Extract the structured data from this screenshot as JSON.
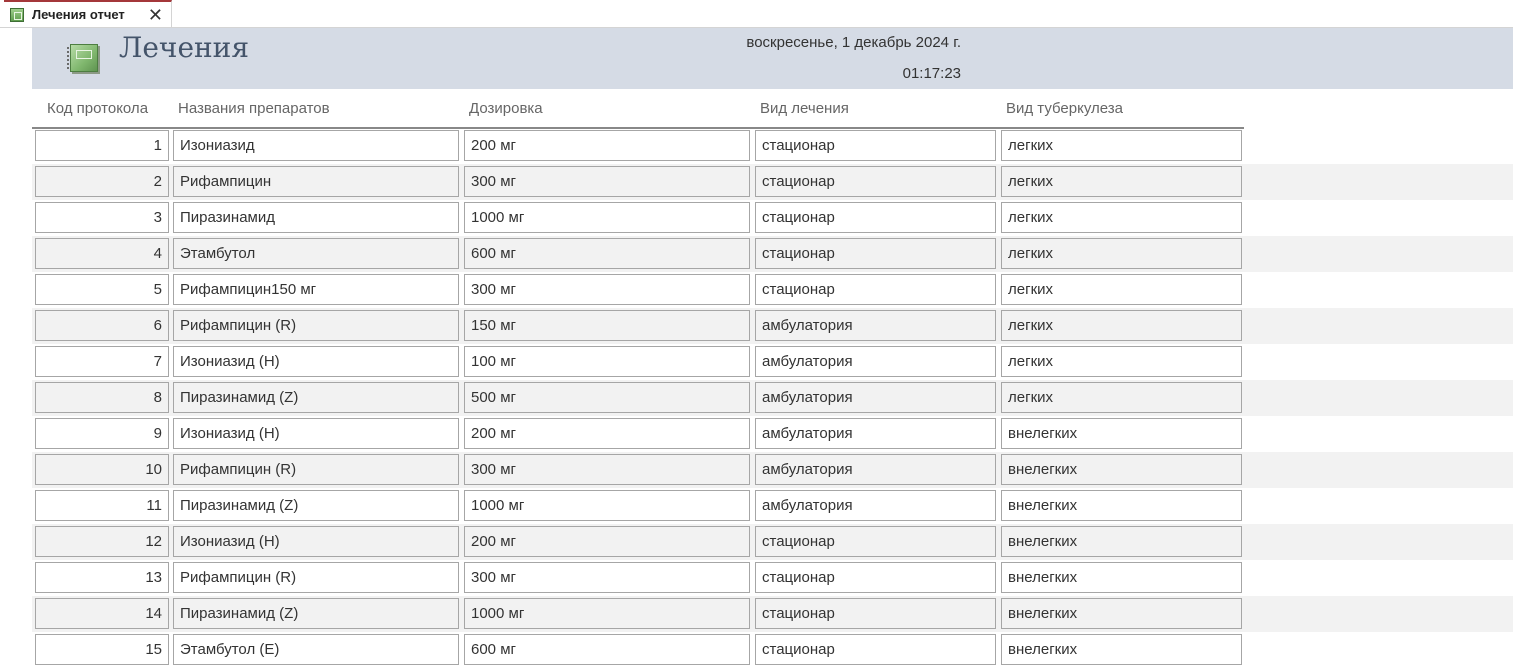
{
  "tab": {
    "title": "Лечения отчет",
    "close_glyph": "✕",
    "icon": "report-icon",
    "accent": "#a4373a"
  },
  "header": {
    "title": "Лечения",
    "date": "воскресенье, 1 декабрь 2024 г.",
    "time": "01:17:23",
    "background": "#d5dbe5",
    "title_color": "#44546a",
    "icon": "report-icon"
  },
  "columns": {
    "id": "Код протокола",
    "name": "Названия препаратов",
    "dose": "Дозировка",
    "type": "Вид лечения",
    "tb": "Вид туберкулеза"
  },
  "rows": [
    {
      "id": "1",
      "name": "Изониазид",
      "dose": "200 мг",
      "type": "стационар",
      "tb": "легких"
    },
    {
      "id": "2",
      "name": "Рифампицин",
      "dose": "300 мг",
      "type": "стационар",
      "tb": "легких"
    },
    {
      "id": "3",
      "name": "Пиразинамид",
      "dose": "1000 мг",
      "type": "стационар",
      "tb": "легких"
    },
    {
      "id": "4",
      "name": "Этамбутол",
      "dose": "600 мг",
      "type": "стационар",
      "tb": "легких"
    },
    {
      "id": "5",
      "name": "Рифампицин150 мг",
      "dose": "300 мг",
      "type": "стационар",
      "tb": "легких"
    },
    {
      "id": "6",
      "name": "Рифампицин (R)",
      "dose": "150 мг",
      "type": "амбулатория",
      "tb": "легких"
    },
    {
      "id": "7",
      "name": "Изониазид (H)",
      "dose": "100 мг",
      "type": "амбулатория",
      "tb": "легких"
    },
    {
      "id": "8",
      "name": "Пиразинамид (Z)",
      "dose": "500 мг",
      "type": "амбулатория",
      "tb": "легких"
    },
    {
      "id": "9",
      "name": "Изониазид (H)",
      "dose": "200 мг",
      "type": "амбулатория",
      "tb": "внелегких"
    },
    {
      "id": "10",
      "name": "Рифампицин (R)",
      "dose": "300 мг",
      "type": "амбулатория",
      "tb": "внелегких"
    },
    {
      "id": "11",
      "name": "Пиразинамид (Z)",
      "dose": "1000 мг",
      "type": "амбулатория",
      "tb": "внелегких"
    },
    {
      "id": "12",
      "name": "Изониазид (H)",
      "dose": "200 мг",
      "type": "стационар",
      "tb": "внелегких"
    },
    {
      "id": "13",
      "name": "Рифампицин (R)",
      "dose": "300 мг",
      "type": "стационар",
      "tb": "внелегких"
    },
    {
      "id": "14",
      "name": "Пиразинамид (Z)",
      "dose": "1000 мг",
      "type": "стационар",
      "tb": "внелегких"
    },
    {
      "id": "15",
      "name": "Этамбутол (E)",
      "dose": "600 мг",
      "type": "стационар",
      "tb": "внелегких"
    }
  ]
}
